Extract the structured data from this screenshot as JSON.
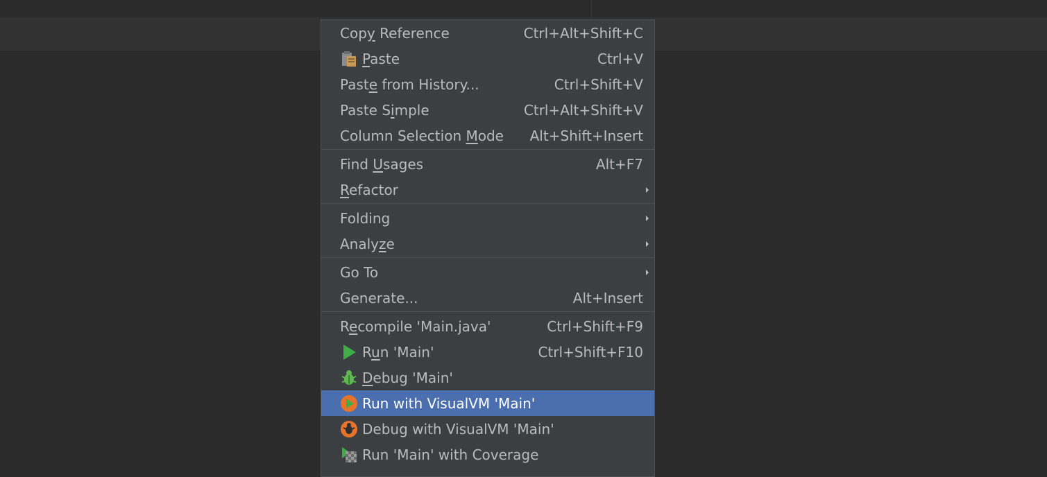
{
  "menu": {
    "groups": [
      [
        {
          "id": "copy-reference",
          "pre": "Cop",
          "mn": "y",
          "post": " Reference",
          "shortcut": "Ctrl+Alt+Shift+C"
        },
        {
          "id": "paste",
          "icon": "clipboard-icon",
          "pre": "",
          "mn": "P",
          "post": "aste",
          "shortcut": "Ctrl+V"
        },
        {
          "id": "paste-from-history",
          "pre": "Past",
          "mn": "e",
          "post": " from History...",
          "shortcut": "Ctrl+Shift+V"
        },
        {
          "id": "paste-simple",
          "pre": "Paste S",
          "mn": "i",
          "post": "mple",
          "shortcut": "Ctrl+Alt+Shift+V"
        },
        {
          "id": "column-selection-mode",
          "pre": "Column Selection ",
          "mn": "M",
          "post": "ode",
          "shortcut": "Alt+Shift+Insert"
        }
      ],
      [
        {
          "id": "find-usages",
          "pre": "Find ",
          "mn": "U",
          "post": "sages",
          "shortcut": "Alt+F7"
        },
        {
          "id": "refactor",
          "pre": "",
          "mn": "R",
          "post": "efactor",
          "submenu": true
        }
      ],
      [
        {
          "id": "folding",
          "pre": "Folding",
          "mn": "",
          "post": "",
          "submenu": true
        },
        {
          "id": "analyze",
          "pre": "Analy",
          "mn": "z",
          "post": "e",
          "submenu": true
        }
      ],
      [
        {
          "id": "go-to",
          "pre": "Go To",
          "mn": "",
          "post": "",
          "submenu": true
        },
        {
          "id": "generate",
          "pre": "Generate...",
          "mn": "",
          "post": "",
          "shortcut": "Alt+Insert"
        }
      ],
      [
        {
          "id": "recompile",
          "pre": "R",
          "mn": "e",
          "post": "compile 'Main.java'",
          "shortcut": "Ctrl+Shift+F9"
        },
        {
          "id": "run-main",
          "icon": "run-icon",
          "pre": "R",
          "mn": "u",
          "post": "n 'Main'",
          "shortcut": "Ctrl+Shift+F10"
        },
        {
          "id": "debug-main",
          "icon": "debug-bug-icon",
          "pre": "",
          "mn": "D",
          "post": "ebug 'Main'"
        },
        {
          "id": "run-visualvm",
          "icon": "visualvm-run-icon",
          "pre": "Run with VisualVM 'Main'",
          "mn": "",
          "post": "",
          "selected": true
        },
        {
          "id": "debug-visualvm",
          "icon": "visualvm-debug-icon",
          "pre": "Debug with VisualVM 'Main'",
          "mn": "",
          "post": ""
        },
        {
          "id": "run-coverage",
          "icon": "coverage-run-icon",
          "pre": "Run 'Main' with Coverage",
          "mn": "",
          "post": ""
        }
      ]
    ]
  },
  "colors": {
    "menu_bg": "#3c3f41",
    "selected_bg": "#4b6eaf",
    "text": "#bbbbbb",
    "run_green": "#3fae49"
  }
}
